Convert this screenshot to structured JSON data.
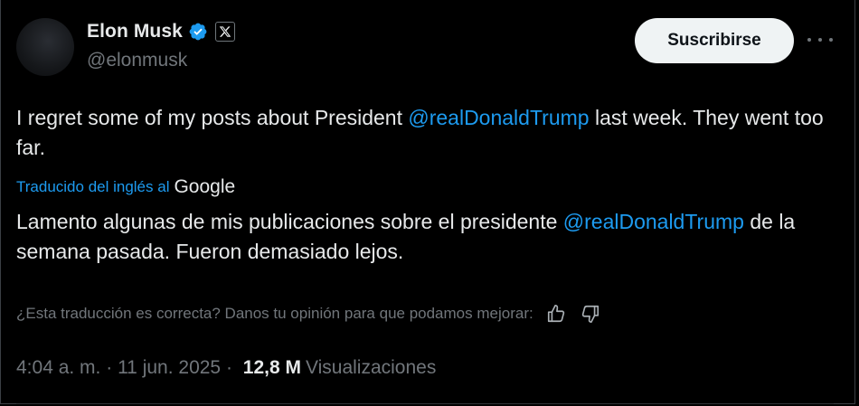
{
  "profile": {
    "name": "Elon Musk",
    "handle": "@elonmusk"
  },
  "actions": {
    "subscribe_label": "Suscribirse"
  },
  "tweet": {
    "segment_1": "I regret some of my posts about President ",
    "mention": "@realDonaldTrump",
    "segment_2": " last week. They went too far."
  },
  "translation": {
    "label": "Traducido del inglés al",
    "provider": "Google",
    "mention": "@realDonaldTrump",
    "segment_1": "Lamento algunas de mis publicaciones sobre el presidente ",
    "segment_2": " de la semana pasada. Fueron demasiado lejos.",
    "feedback_text": "¿Esta traducción es correcta? Danos tu opinión para que podamos mejorar:"
  },
  "meta": {
    "time": "4:04 a. m.",
    "separator": " · ",
    "date": "11 jun. 2025",
    "separator_2": " · ",
    "views_count": "12,8 M",
    "views_label": "Visualizaciones"
  },
  "colors": {
    "background": "#000000",
    "accent": "#1d9bf0",
    "text": "#e7e9ea",
    "muted": "#71767b"
  }
}
